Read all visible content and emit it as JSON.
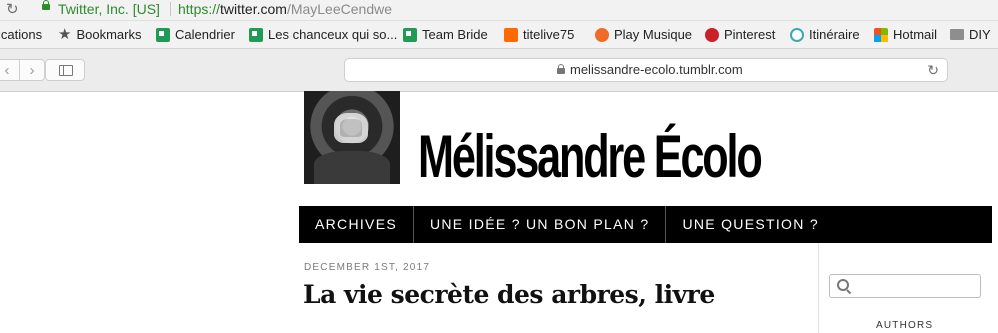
{
  "browser": {
    "ev_label": "Twitter, Inc. [US]",
    "url_scheme": "https://",
    "url_host": "twitter.com",
    "url_path": "/MayLeeCendwe"
  },
  "bookmarks": [
    {
      "label": "ications",
      "icon": "none"
    },
    {
      "label": "Bookmarks",
      "icon": "star-icon"
    },
    {
      "label": "Calendrier",
      "icon": "sheets-icon"
    },
    {
      "label": "Les chanceux qui so...",
      "icon": "sheets-icon"
    },
    {
      "label": "Team Bride",
      "icon": "sheets-icon"
    },
    {
      "label": "titelive75",
      "icon": "soundcloud-icon"
    },
    {
      "label": "Play Musique",
      "icon": "play-music-icon"
    },
    {
      "label": "Pinterest",
      "icon": "pinterest-icon"
    },
    {
      "label": "Itinéraire",
      "icon": "itinerary-icon"
    },
    {
      "label": "Hotmail",
      "icon": "microsoft-icon"
    },
    {
      "label": "DIY",
      "icon": "folder-icon"
    }
  ],
  "toolbar": {
    "omnibox_text": "melissandre-ecolo.tumblr.com"
  },
  "blog": {
    "title": "Mélissandre Écolo",
    "nav": [
      "ARCHIVES",
      "UNE IDÉE ? UN BON PLAN ?",
      "UNE QUESTION ?"
    ],
    "post_date": "DECEMBER 1ST, 2017",
    "post_title": "La vie secrète des arbres, livre",
    "search_placeholder": "",
    "sidebar_heading": "AUTHORS"
  }
}
